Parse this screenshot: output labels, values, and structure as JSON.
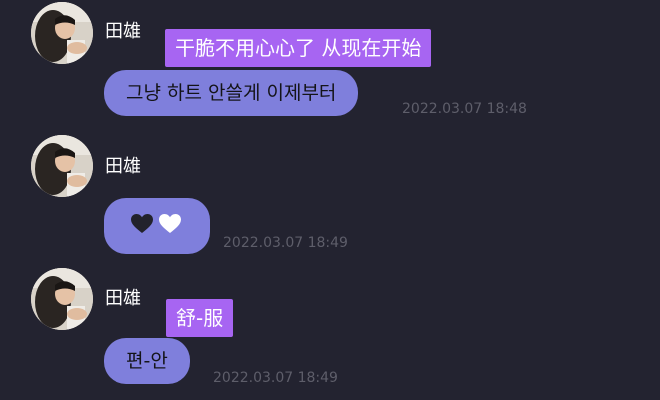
{
  "messages": [
    {
      "sender": "田雄",
      "highlight": "干脆不用心心了 从现在开始",
      "bubble": "그냥 하트 안쓸게 이제부터",
      "timestamp": "2022.03.07 18:48"
    },
    {
      "sender": "田雄",
      "bubble_icons": [
        "black-heart-icon",
        "white-heart-icon"
      ],
      "timestamp": "2022.03.07 18:49"
    },
    {
      "sender": "田雄",
      "highlight": "舒-服",
      "bubble": "편-안",
      "timestamp": "2022.03.07 18:49"
    }
  ],
  "colors": {
    "background": "#232330",
    "bubble": "#7f7fdc",
    "highlight": "#a765f2",
    "timestamp": "#5e5e6a",
    "sender": "#ffffff"
  }
}
